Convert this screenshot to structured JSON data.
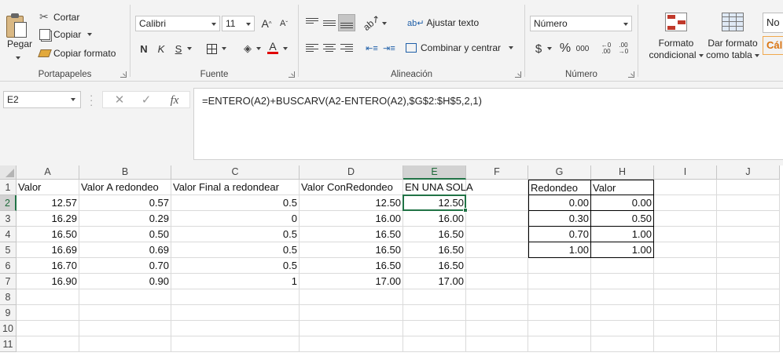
{
  "ribbon": {
    "clipboard": {
      "label": "Portapapeles",
      "paste": "Pegar",
      "cut": "Cortar",
      "copy": "Copiar",
      "format_painter": "Copiar formato"
    },
    "font": {
      "label": "Fuente",
      "name": "Calibri",
      "size": "11",
      "bold": "N",
      "italic": "K",
      "underline": "S",
      "grow": "A",
      "shrink": "A",
      "font_color_letter": "A"
    },
    "alignment": {
      "label": "Alineación",
      "wrap_text": "Ajustar texto",
      "merge_center": "Combinar y centrar"
    },
    "number": {
      "label": "Número",
      "format": "Número",
      "currency": "$",
      "percent": "%",
      "thousands": "000"
    },
    "styles": {
      "conditional_line1": "Formato",
      "conditional_line2": "condicional",
      "table_line1": "Dar formato",
      "table_line2": "como tabla",
      "partial_style_top": "No",
      "partial_style_bottom": "Cál"
    }
  },
  "formula_bar": {
    "name_box": "E2",
    "fx": "fx",
    "formula": "=ENTERO(A2)+BUSCARV(A2-ENTERO(A2),$G$2:$H$5,2,1)"
  },
  "grid": {
    "columns": [
      "A",
      "B",
      "C",
      "D",
      "E",
      "F",
      "G",
      "H",
      "I",
      "J"
    ],
    "rows": [
      "1",
      "2",
      "3",
      "4",
      "5",
      "6",
      "7",
      "8",
      "9",
      "10",
      "11"
    ],
    "selected_cell": "E2",
    "headers": {
      "A": "Valor",
      "B": "Valor A redondeo",
      "C": "Valor Final a redondear",
      "D": "Valor ConRedondeo",
      "E": "EN UNA SOLA",
      "G": "Redondeo",
      "H": "Valor"
    },
    "data": [
      [
        "12.57",
        "0.57",
        "0.5",
        "12.50",
        "12.50"
      ],
      [
        "16.29",
        "0.29",
        "0",
        "16.00",
        "16.00"
      ],
      [
        "16.50",
        "0.50",
        "0.5",
        "16.50",
        "16.50"
      ],
      [
        "16.69",
        "0.69",
        "0.5",
        "16.50",
        "16.50"
      ],
      [
        "16.70",
        "0.70",
        "0.5",
        "16.50",
        "16.50"
      ],
      [
        "16.90",
        "0.90",
        "1",
        "17.00",
        "17.00"
      ]
    ],
    "lookup": [
      [
        "0.00",
        "0.00"
      ],
      [
        "0.30",
        "0.50"
      ],
      [
        "0.70",
        "1.00"
      ],
      [
        "1.00",
        "1.00"
      ]
    ]
  },
  "colors": {
    "accent_green": "#217346",
    "font_color_bar": "#e00000"
  }
}
